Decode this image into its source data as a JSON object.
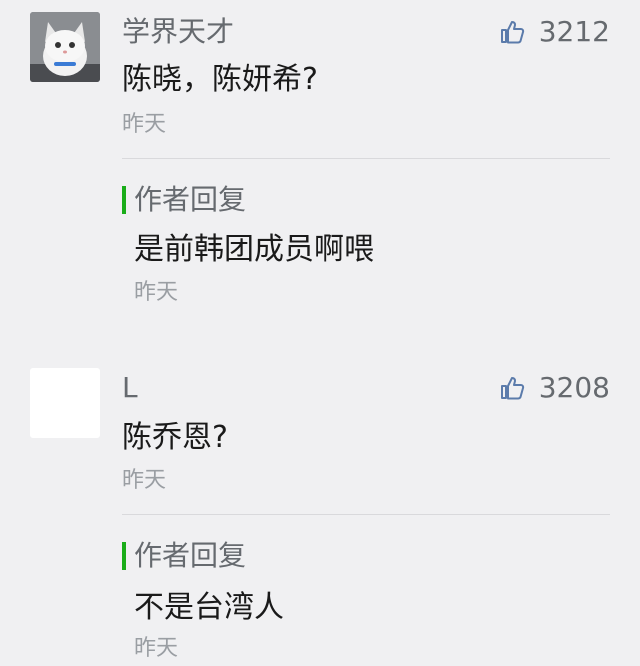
{
  "comments": [
    {
      "author": "学界天才",
      "likes": "3212",
      "text": "陈晓，陈妍希?",
      "time": "昨天",
      "avatar": "cat-avatar",
      "reply": {
        "label": "作者回复",
        "text": "是前韩团成员啊喂",
        "time": "昨天"
      }
    },
    {
      "author": "L",
      "likes": "3208",
      "text": "陈乔恩?",
      "time": "昨天",
      "avatar": "blank-avatar",
      "reply": {
        "label": "作者回复",
        "text": "不是台湾人",
        "time": "昨天"
      }
    }
  ],
  "colors": {
    "background": "#f0f0f2",
    "reply_accent": "#1aad19",
    "muted_text": "#666a6f",
    "time_text": "#9a9ea3"
  },
  "icons": {
    "like": "thumbs-up-icon"
  }
}
